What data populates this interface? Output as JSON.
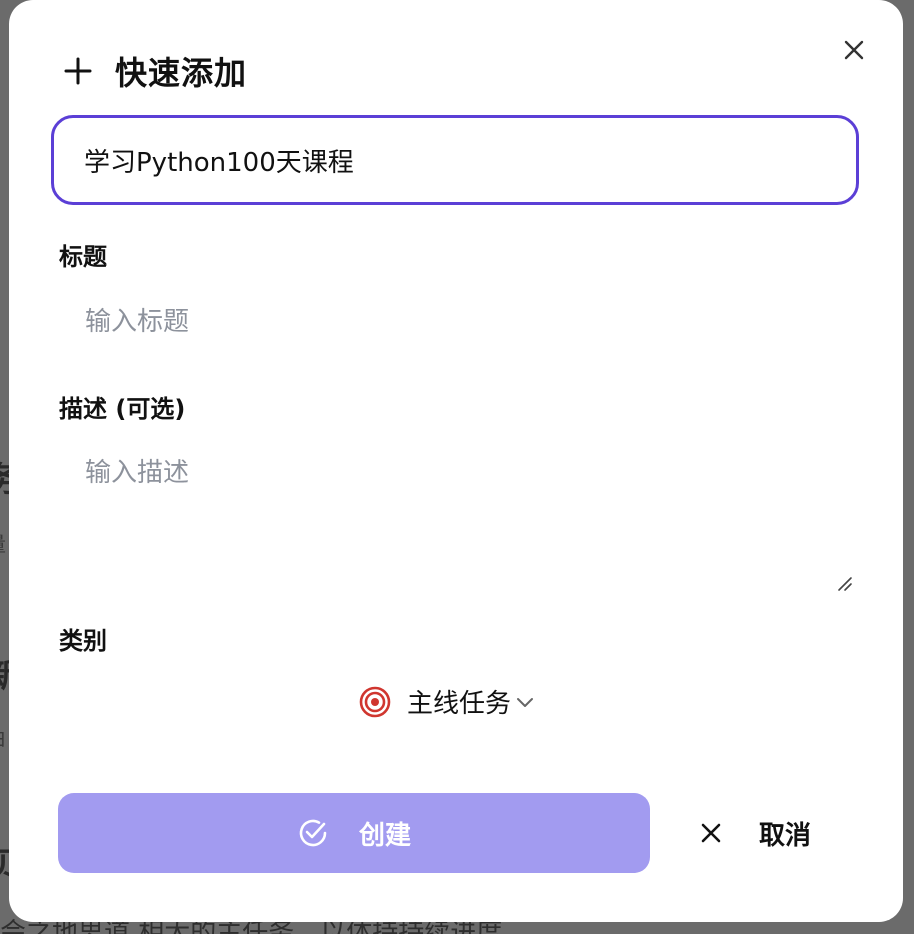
{
  "dialog": {
    "title": "快速添加",
    "quick_input_value": "学习Python100天课程"
  },
  "fields": {
    "title_label": "标题",
    "title_placeholder": "输入标题",
    "description_label": "描述 (可选)",
    "description_placeholder": "输入描述",
    "category_label": "类别",
    "category_value": "主线任务"
  },
  "actions": {
    "create_label": "创建",
    "cancel_label": "取消"
  },
  "background": {
    "fragment_1": "务",
    "fragment_2": "量",
    "fragment_3": "新",
    "fragment_4": "伯",
    "fragment_5": "贝",
    "bottom_text": "会之地思道 相大的主任务，以体持持续进度。"
  },
  "colors": {
    "accent": "#5b3fd6",
    "create_button": "#a29bf0",
    "category_icon": "#d0362f"
  },
  "icons": {
    "close": "close-icon",
    "plus": "plus-icon",
    "category": "target-icon",
    "dropdown": "chevron-down-icon",
    "create": "check-circle-icon",
    "cancel": "x-icon"
  }
}
